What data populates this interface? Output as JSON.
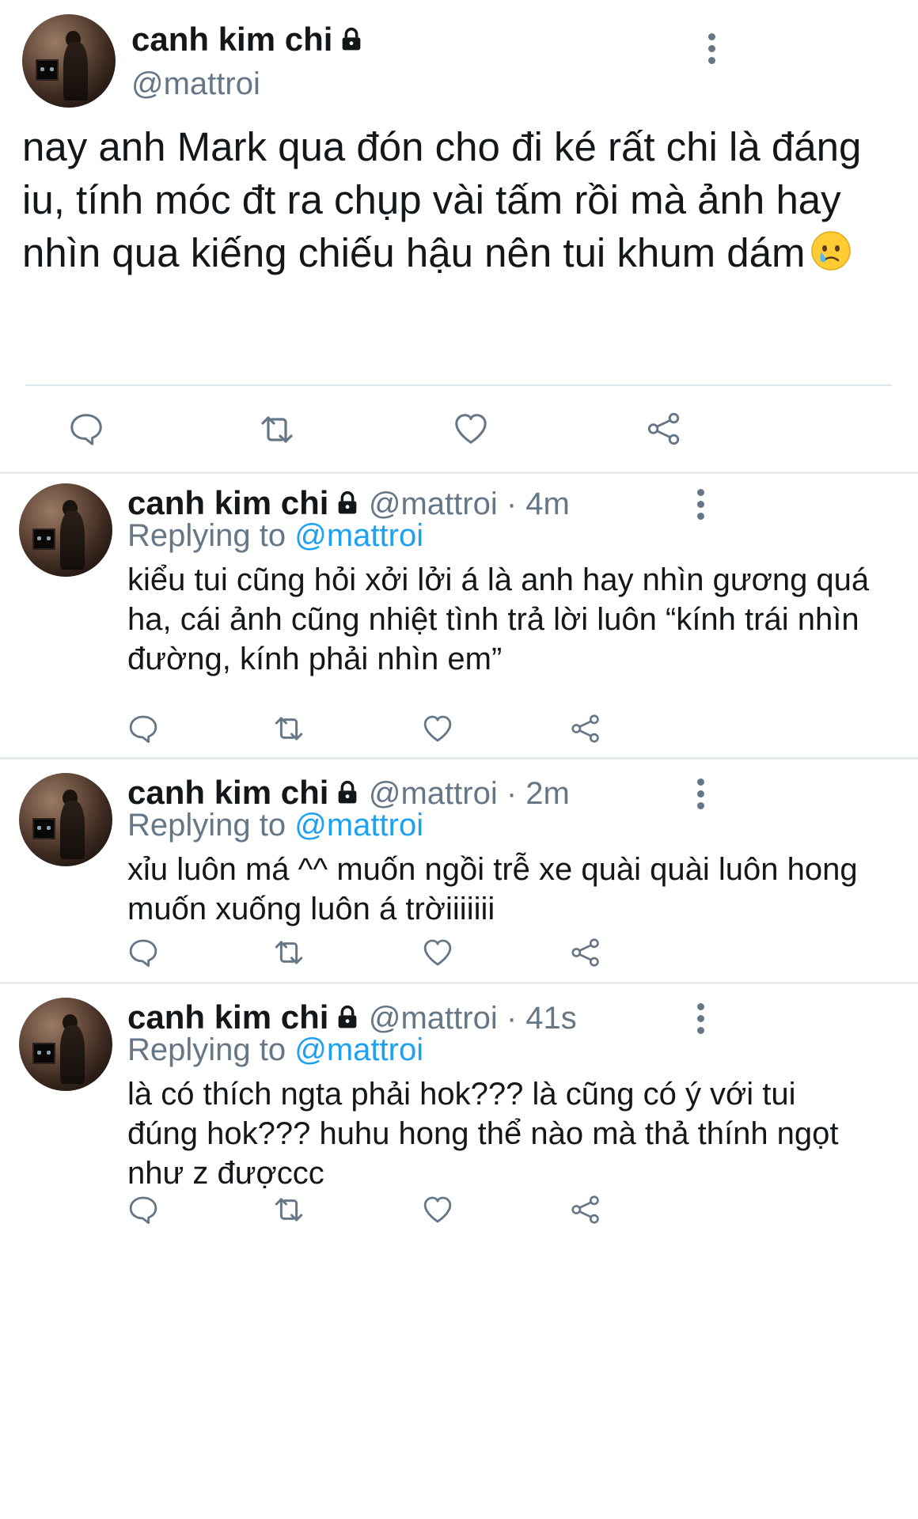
{
  "main": {
    "name": "canh kim chi",
    "handle": "@mattroi",
    "text": "nay anh Mark qua đón cho đi ké rất chi là đáng iu, tính móc đt ra chụp vài tấm rồi mà ảnh hay nhìn qua kiếng chiếu hậu nên tui khum dám"
  },
  "icons": {
    "reply": "reply-icon",
    "retweet": "retweet-icon",
    "like": "heart-icon",
    "share": "share-icon",
    "lock": "lock-icon",
    "more": "more-vertical-icon",
    "emoji": "crying-face-emoji"
  },
  "replies": [
    {
      "name": "canh kim chi",
      "meta": "@mattroi · 4m",
      "replying_label": "Replying to",
      "replying_handle": "@mattroi",
      "text": "kiểu tui cũng hỏi xởi lởi á là anh hay nhìn gương quá ha, cái ảnh cũng nhiệt tình trả lời luôn “kính trái nhìn đường, kính phải nhìn em”"
    },
    {
      "name": "canh kim chi",
      "meta": "@mattroi · 2m",
      "replying_label": "Replying to",
      "replying_handle": "@mattroi",
      "text": "xỉu luôn má ^^ muốn ngồi trễ xe quài quài luôn hong muốn xuống luôn á trờiiiiiii"
    },
    {
      "name": "canh kim chi",
      "meta": "@mattroi · 41s",
      "replying_label": "Replying to",
      "replying_handle": "@mattroi",
      "text": "là có thích ngta phải hok??? là cũng có ý với tui đúng hok??? huhu hong thể nào mà thả thính ngọt như z đượccc"
    }
  ],
  "colors": {
    "text": "#14171a",
    "secondary": "#657786",
    "link": "#1da1f2",
    "divider": "#e6ecf0"
  }
}
